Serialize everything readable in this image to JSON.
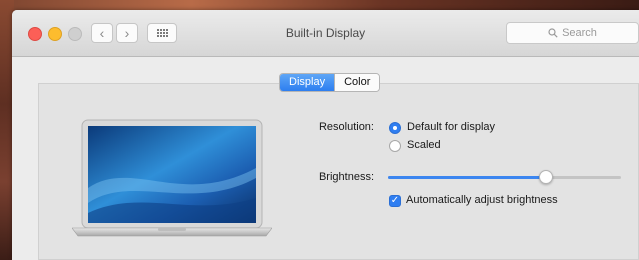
{
  "window": {
    "title": "Built-in Display",
    "search_placeholder": "Search",
    "nav_back": "‹",
    "nav_forward": "›"
  },
  "tabs": [
    {
      "label": "Display",
      "active": true
    },
    {
      "label": "Color",
      "active": false
    }
  ],
  "resolution": {
    "label": "Resolution:",
    "options": [
      {
        "label": "Default for display",
        "selected": true
      },
      {
        "label": "Scaled",
        "selected": false
      }
    ]
  },
  "brightness": {
    "label": "Brightness:",
    "level": 0.68
  },
  "auto_brightness": {
    "label": "Automatically adjust brightness",
    "checked": true
  },
  "colors": {
    "accent": "#2f7ef1",
    "close": "#fc5f57",
    "minimize": "#fdbc2e",
    "maximize_disabled": "#cfcfcf"
  },
  "icons": {
    "grid": "grid-icon",
    "search": "search-icon",
    "laptop": "laptop-icon",
    "check": "✓"
  }
}
